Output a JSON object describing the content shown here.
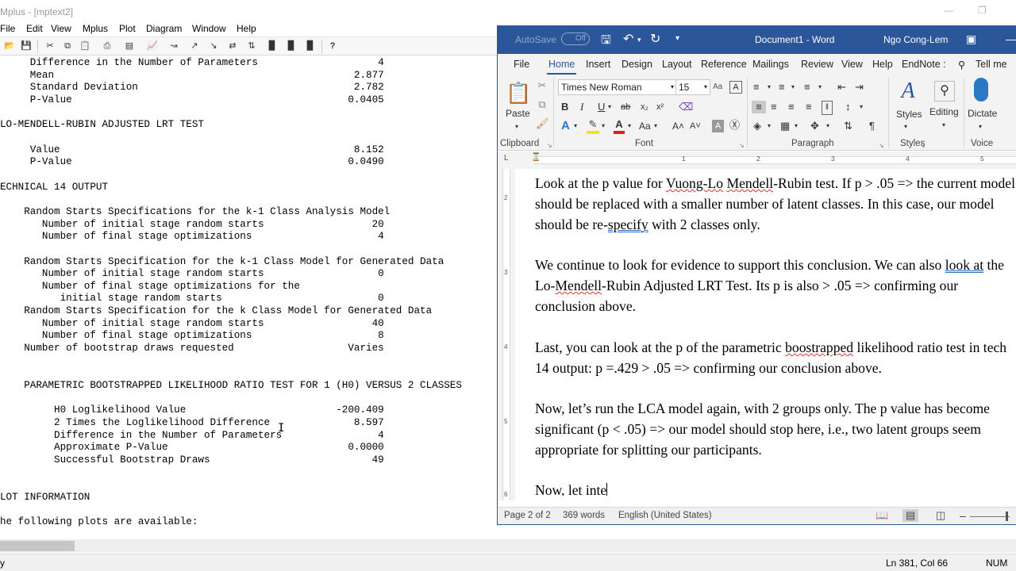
{
  "mplus": {
    "title": "Mplus - [mptext2]",
    "menu": [
      "File",
      "Edit",
      "View",
      "Mplus",
      "Plot",
      "Diagram",
      "Window",
      "Help"
    ],
    "help_button": "?",
    "output_lines": [
      "     Difference in the Number of Parameters                    4",
      "     Mean                                                  2.877",
      "     Standard Deviation                                    2.782",
      "     P-Value                                              0.0405",
      "",
      "LO-MENDELL-RUBIN ADJUSTED LRT TEST",
      "",
      "     Value                                                 8.152",
      "     P-Value                                              0.0490",
      "",
      "ECHNICAL 14 OUTPUT",
      "",
      "    Random Starts Specifications for the k-1 Class Analysis Model",
      "       Number of initial stage random starts                  20",
      "       Number of final stage optimizations                     4",
      "",
      "    Random Starts Specification for the k-1 Class Model for Generated Data",
      "       Number of initial stage random starts                   0",
      "       Number of final stage optimizations for the",
      "          initial stage random starts                          0",
      "    Random Starts Specification for the k Class Model for Generated Data",
      "       Number of initial stage random starts                  40",
      "       Number of final stage optimizations                     8",
      "    Number of bootstrap draws requested                   Varies",
      "",
      "",
      "    PARAMETRIC BOOTSTRAPPED LIKELIHOOD RATIO TEST FOR 1 (H0) VERSUS 2 CLASSES",
      "",
      "         H0 Loglikelihood Value                         -200.409",
      "         2 Times the Loglikelihood Difference              8.597",
      "         Difference in the Number of Parameters                4",
      "         Approximate P-Value                              0.0000",
      "         Successful Bootstrap Draws                           49",
      "",
      "",
      "LOT INFORMATION",
      "",
      "he following plots are available:"
    ],
    "status": {
      "position": "Ln 381, Col 66",
      "num": "NUM"
    }
  },
  "word": {
    "autosave": "AutoSave",
    "autosave_state": "Off",
    "doc_title": "Document1  -  Word",
    "user": "Ngo Cong-Lem",
    "tabs": [
      "File",
      "Home",
      "Insert",
      "Design",
      "Layout",
      "Reference",
      "Mailings",
      "Review",
      "View",
      "Help",
      "EndNote :",
      "Tell me"
    ],
    "ribbon": {
      "paste_label": "Paste",
      "font_name": "Times New Roman",
      "font_size": "15",
      "styles_label": "Styles",
      "editing_label": "Editing",
      "dictate_label": "Dictate",
      "groups": [
        "Clipboard",
        "Font",
        "Paragraph",
        "Styles",
        "Voice"
      ]
    },
    "ruler_numbers": [
      "1",
      "2",
      "3",
      "4",
      "5"
    ],
    "vruler_numbers": [
      "2",
      "3",
      "4",
      "5",
      "6"
    ],
    "paragraphs": {
      "p1_a": "Look at the p value for ",
      "p1_sq1": "Vuong-Lo",
      "p1_b": " ",
      "p1_sq2": "Mendell",
      "p1_c": "-Rubin test. If p > .05 => the current model should be replaced with a smaller number of latent classes. In this case, our model should be re-",
      "p1_sq3": "specify",
      "p1_d": " with 2 classes only.",
      "p2_a": "We continue to look for evidence to support this conclusion. We can also ",
      "p2_sq1": "look  at",
      "p2_b": " the Lo-",
      "p2_sq2": "Mendell",
      "p2_c": "-Rubin Adjusted LRT Test. Its p is also > .05 => confirming our conclusion above.",
      "p3_a": "Last, you can look at the p of the parametric ",
      "p3_sq1": "boostrapped",
      "p3_b": " likelihood ratio test in tech 14 output: p =.429 > .05 => confirming our conclusion above.",
      "p4": "Now, let’s run the LCA model again, with 2 groups only. The p value has become significant (p < .05) => our model should stop here, i.e., two latent groups seem appropriate for splitting our participants.",
      "p5": "Now, let inte"
    },
    "status": {
      "page": "Page 2 of 2",
      "words": "369 words",
      "language": "English (United States)"
    }
  }
}
